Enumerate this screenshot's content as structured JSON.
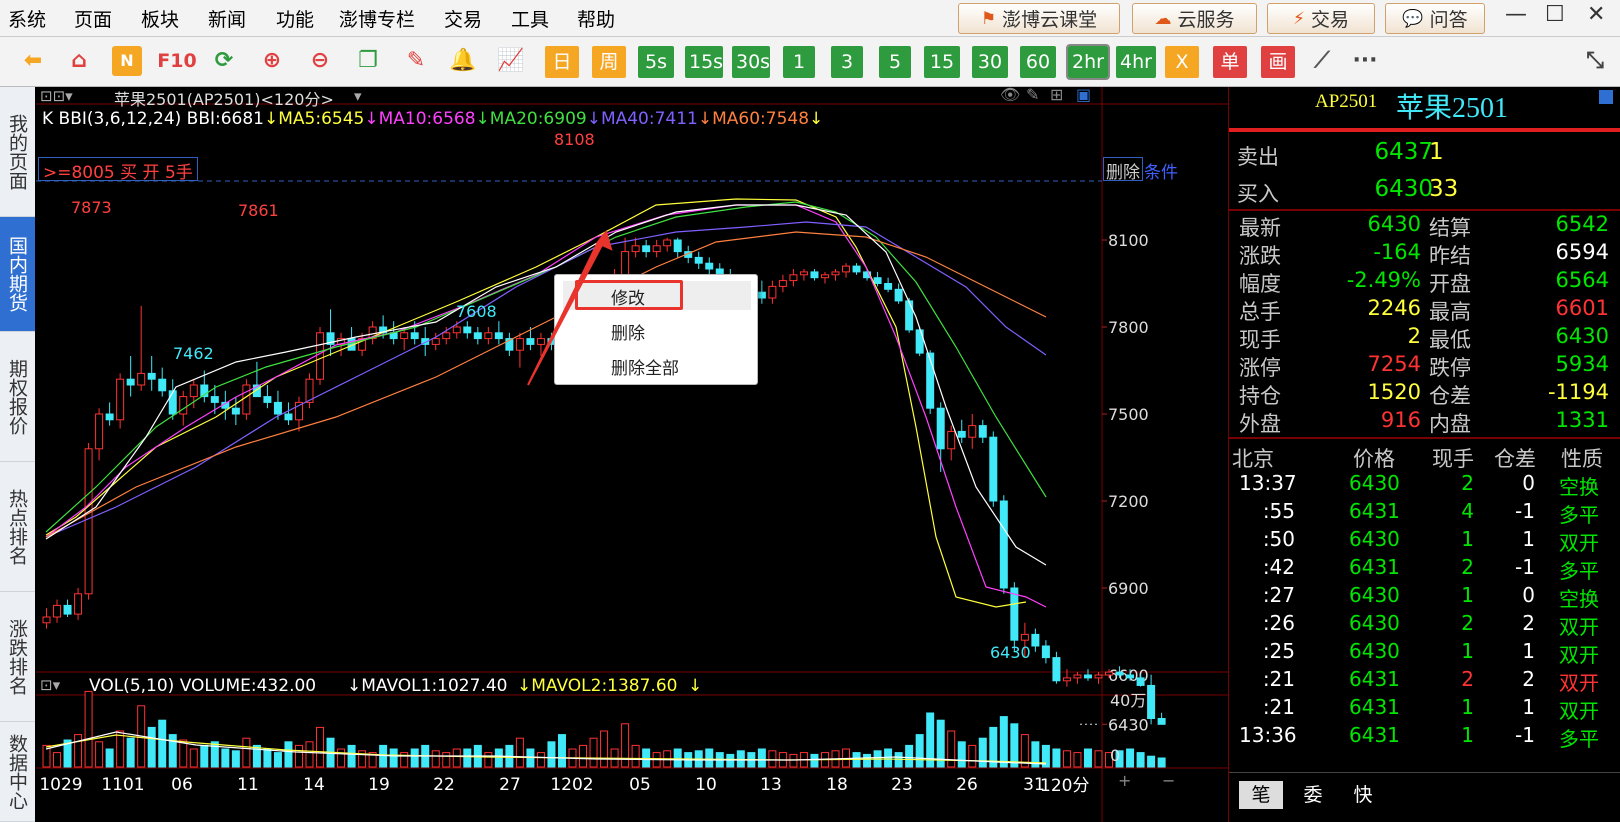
{
  "menubar": {
    "items": [
      "系统",
      "页面",
      "板块",
      "新闻",
      "功能",
      "澎博专栏",
      "交易",
      "工具",
      "帮助"
    ],
    "buttons": {
      "cloud_class": "澎博云课堂",
      "cloud_service": "云服务",
      "trade": "交易",
      "qa": "问答"
    },
    "window": {
      "minimize": "—",
      "maximize": "☐",
      "close": "✕"
    }
  },
  "toolbar": {
    "f10": "F10",
    "periods": [
      "日",
      "周",
      "5s",
      "15s",
      "30s",
      "1",
      "3",
      "5",
      "15",
      "30",
      "60",
      "2hr",
      "4hr",
      "X",
      "单",
      "画"
    ],
    "selected_period": "2hr",
    "more": "···"
  },
  "leftnav": [
    "我的页面",
    "国内期货",
    "期权报价",
    "热点排名",
    "涨跌排名",
    "数据中心"
  ],
  "chart": {
    "title": "苹果2501(AP2501)<120分>",
    "indicator_line": [
      {
        "text": "K  BBI(3,6,12,24) BBI:6681",
        "color": "#ffffff"
      },
      {
        "text": "↓MA5:6545",
        "color": "#ffff3c"
      },
      {
        "text": "↓MA10:6568",
        "color": "#ff40ff"
      },
      {
        "text": "↓MA20:6909",
        "color": "#40e040"
      },
      {
        "text": "↓MA40:7411",
        "color": "#8060ff"
      },
      {
        "text": "↓MA60:7548",
        "color": "#ff8040"
      },
      {
        "text": "↓",
        "color": "#ffff3c"
      }
    ],
    "condition_order": ">=8005  买  开  5手",
    "delete_label": "删除",
    "condition_label": "条件",
    "price_ticks": [
      "8100",
      "7800",
      "7500",
      "7200",
      "6900",
      "6600",
      "6430"
    ],
    "annotations": [
      "7873",
      "7861",
      "8108",
      "7462",
      "7608",
      "6430"
    ],
    "volume_header": {
      "label": "VOL(5,10) VOLUME:432.00",
      "mavol1": "↓MAVOL1:1027.40",
      "mavol2": "↓MAVOL2:1387.60",
      "arrow": "↓"
    },
    "volume_ticks": [
      "40万",
      "0"
    ],
    "x_labels": [
      "1029",
      "1101",
      "06",
      "11",
      "14",
      "19",
      "22",
      "27",
      "1202",
      "05",
      "10",
      "13",
      "18",
      "23",
      "26",
      "31"
    ],
    "period_label": "120分",
    "bottom_controls": [
      "+",
      "−"
    ]
  },
  "context_menu": {
    "items": [
      "修改",
      "删除",
      "删除全部"
    ]
  },
  "quote": {
    "code": "AP2501",
    "name": "苹果2501",
    "sell": {
      "label": "卖出",
      "price": "6437",
      "volume": "1"
    },
    "buy": {
      "label": "买入",
      "price": "6430",
      "volume": "33"
    },
    "stats": [
      {
        "l1": "最新",
        "v1": "6430",
        "c1": "green",
        "l2": "结算",
        "v2": "6542",
        "c2": "green"
      },
      {
        "l1": "涨跌",
        "v1": "-164",
        "c1": "green",
        "l2": "昨结",
        "v2": "6594",
        "c2": "white"
      },
      {
        "l1": "幅度",
        "v1": "-2.49%",
        "c1": "green",
        "l2": "开盘",
        "v2": "6564",
        "c2": "green"
      },
      {
        "l1": "总手",
        "v1": "2246",
        "c1": "yellow",
        "l2": "最高",
        "v2": "6601",
        "c2": "red"
      },
      {
        "l1": "现手",
        "v1": "2",
        "c1": "yellow",
        "l2": "最低",
        "v2": "6430",
        "c2": "green"
      },
      {
        "l1": "涨停",
        "v1": "7254",
        "c1": "red",
        "l2": "跌停",
        "v2": "5934",
        "c2": "green"
      },
      {
        "l1": "持仓",
        "v1": "1520",
        "c1": "yellow",
        "l2": "仓差",
        "v2": "-1194",
        "c2": "yellow"
      },
      {
        "l1": "外盘",
        "v1": "916",
        "c1": "red",
        "l2": "内盘",
        "v2": "1331",
        "c2": "green"
      }
    ],
    "ticks_header": [
      "北京",
      "价格",
      "现手",
      "仓差",
      "性质"
    ],
    "ticks": [
      {
        "time": "13:37",
        "price": "6430",
        "vol": "2",
        "chg": "0",
        "nature": "空换",
        "vc": "green",
        "nc": "green"
      },
      {
        "time": ":55",
        "price": "6431",
        "vol": "4",
        "chg": "-1",
        "nature": "多平",
        "vc": "green",
        "nc": "green"
      },
      {
        "time": ":50",
        "price": "6430",
        "vol": "1",
        "chg": "1",
        "nature": "双开",
        "vc": "green",
        "nc": "green"
      },
      {
        "time": ":42",
        "price": "6431",
        "vol": "2",
        "chg": "-1",
        "nature": "多平",
        "vc": "green",
        "nc": "green"
      },
      {
        "time": ":27",
        "price": "6430",
        "vol": "1",
        "chg": "0",
        "nature": "空换",
        "vc": "green",
        "nc": "green"
      },
      {
        "time": ":26",
        "price": "6430",
        "vol": "2",
        "chg": "2",
        "nature": "双开",
        "vc": "green",
        "nc": "green"
      },
      {
        "time": ":25",
        "price": "6430",
        "vol": "1",
        "chg": "1",
        "nature": "双开",
        "vc": "green",
        "nc": "green"
      },
      {
        "time": ":21",
        "price": "6431",
        "vol": "2",
        "chg": "2",
        "nature": "双开",
        "vc": "red",
        "nc": "red"
      },
      {
        "time": ":21",
        "price": "6431",
        "vol": "1",
        "chg": "1",
        "nature": "双开",
        "vc": "green",
        "nc": "green"
      },
      {
        "time": "13:36",
        "price": "6431",
        "vol": "1",
        "chg": "-1",
        "nature": "多平",
        "vc": "green",
        "nc": "green"
      }
    ],
    "tabs": [
      "笔",
      "委",
      "快"
    ]
  },
  "colors": {
    "up": "#ff3232",
    "down": "#40e8f8",
    "accent": "#2f6fd1"
  }
}
